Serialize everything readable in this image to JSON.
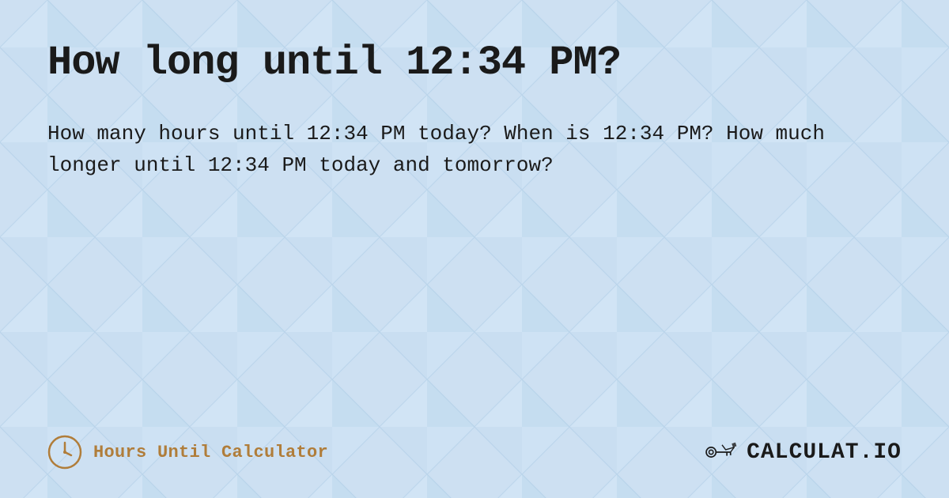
{
  "page": {
    "title": "How long until 12:34 PM?",
    "description": "How many hours until 12:34 PM today? When is 12:34 PM? How much longer until 12:34 PM today and tomorrow?",
    "background_color": "#c8dff0"
  },
  "footer": {
    "brand_text": "Hours Until Calculator",
    "logo_text": "CALCULAT.IO"
  },
  "icons": {
    "clock": "clock-icon",
    "calculat": "calculat-brand-icon"
  }
}
